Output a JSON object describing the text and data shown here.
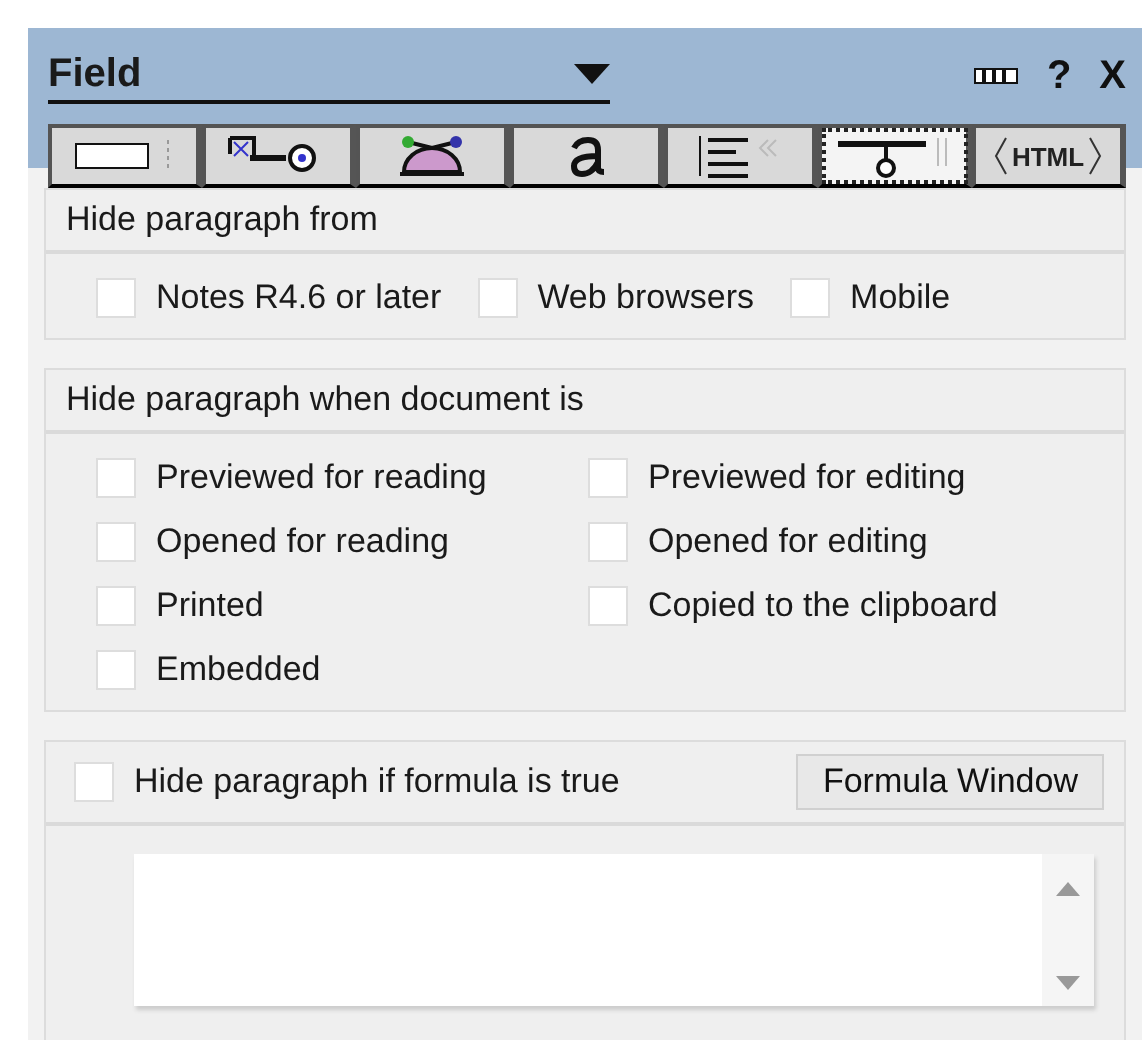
{
  "panel": {
    "title": "Field",
    "help_label": "?",
    "close_label": "X"
  },
  "tabs": [
    {
      "kind": "field",
      "selected": false
    },
    {
      "kind": "control",
      "selected": false
    },
    {
      "kind": "properties",
      "selected": false
    },
    {
      "kind": "font",
      "selected": false
    },
    {
      "kind": "paragraph",
      "selected": false
    },
    {
      "kind": "hide",
      "selected": true
    },
    {
      "kind": "html",
      "label": "HTML",
      "selected": false
    }
  ],
  "hide_from": {
    "heading": "Hide paragraph from",
    "options": [
      {
        "label": "Notes R4.6 or later",
        "checked": false
      },
      {
        "label": "Web browsers",
        "checked": false
      },
      {
        "label": "Mobile",
        "checked": false
      }
    ]
  },
  "hide_when": {
    "heading": "Hide paragraph when document is",
    "options": [
      {
        "label": "Previewed for reading",
        "checked": false
      },
      {
        "label": "Previewed for editing",
        "checked": false
      },
      {
        "label": "Opened for reading",
        "checked": false
      },
      {
        "label": "Opened for editing",
        "checked": false
      },
      {
        "label": "Printed",
        "checked": false
      },
      {
        "label": "Copied to the clipboard",
        "checked": false
      },
      {
        "label": "Embedded",
        "checked": false
      }
    ]
  },
  "formula": {
    "label": "Hide paragraph if formula is true",
    "checked": false,
    "button": "Formula Window"
  }
}
